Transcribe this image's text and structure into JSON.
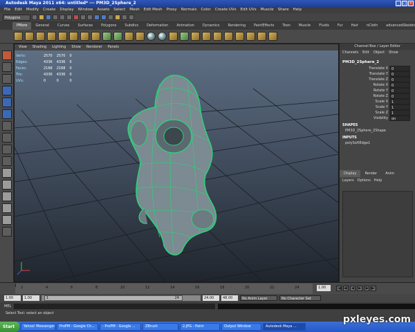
{
  "window": {
    "title": "Autodesk Maya 2011 x64: untitled*  ---  PM3D_2Sphere_2",
    "buttons": [
      "_",
      "□",
      "✕"
    ]
  },
  "menubar": [
    "File",
    "Edit",
    "Modify",
    "Create",
    "Display",
    "Window",
    "Assets",
    "Select",
    "Mesh",
    "Edit Mesh",
    "Proxy",
    "Normals",
    "Color",
    "Create UVs",
    "Edit UVs",
    "Muscle",
    "Share",
    "Help"
  ],
  "statusline": {
    "mode": "Polygons"
  },
  "shelf_tabs": [
    "PMore",
    "General",
    "Curves",
    "Surfaces",
    "Polygons",
    "Subdivs",
    "Deformation",
    "Animation",
    "Dynamics",
    "Rendering",
    "PaintEffects",
    "Toon",
    "Muscle",
    "Fluids",
    "Fur",
    "Hair",
    "nCloth",
    "advancedSkeleton"
  ],
  "shelf_active": "PMore",
  "viewport": {
    "menu": [
      "View",
      "Shading",
      "Lighting",
      "Show",
      "Renderer",
      "Panels"
    ],
    "hud": [
      {
        "label": "Verts:",
        "a": "2570",
        "b": "2570",
        "c": "0"
      },
      {
        "label": "Edges:",
        "a": "4336",
        "b": "4336",
        "c": "0"
      },
      {
        "label": "Faces:",
        "a": "2168",
        "b": "2168",
        "c": "0"
      },
      {
        "label": "Tris:",
        "a": "4336",
        "b": "4336",
        "c": "0"
      },
      {
        "label": "UVs:",
        "a": "0",
        "b": "0",
        "c": "0"
      }
    ],
    "mesh_color": "#2fd07a"
  },
  "channel_box": {
    "title": "Channel Box / Layer Editor",
    "menu": [
      "Channels",
      "Edit",
      "Object",
      "Show"
    ],
    "object": "PM3D_2Sphere_2",
    "attrs": [
      {
        "name": "Translate X",
        "value": "0"
      },
      {
        "name": "Translate Y",
        "value": "0"
      },
      {
        "name": "Translate Z",
        "value": "0"
      },
      {
        "name": "Rotate X",
        "value": "0"
      },
      {
        "name": "Rotate Y",
        "value": "0"
      },
      {
        "name": "Rotate Z",
        "value": "0"
      },
      {
        "name": "Scale X",
        "value": "1"
      },
      {
        "name": "Scale Y",
        "value": "1"
      },
      {
        "name": "Scale Z",
        "value": "1"
      },
      {
        "name": "Visibility",
        "value": "on"
      }
    ],
    "shapes_label": "SHAPES",
    "shape": "PM3D_2Sphere_2Shape",
    "inputs_label": "INPUTS",
    "input": "polySoftEdge1"
  },
  "layer_editor": {
    "tabs": [
      "Display",
      "Render",
      "Anim"
    ],
    "menu": [
      "Layers",
      "Options",
      "Help"
    ]
  },
  "timeline": {
    "ticks": [
      "2",
      "4",
      "6",
      "8",
      "10",
      "12",
      "14",
      "16",
      "18",
      "20",
      "22",
      "24"
    ],
    "current_frame": "1.00",
    "play_buttons": [
      "|◀",
      "◀|",
      "◀",
      "▶",
      "|▶",
      "▶|"
    ]
  },
  "range": {
    "start": "1.00",
    "start2": "1.00",
    "slider_start": "1",
    "slider_end": "24",
    "end": "24.00",
    "end2": "48.00",
    "anim_layer": "No Anim Layer",
    "character_set": "No Character Set"
  },
  "mel_label": "MEL",
  "help_text": "Select Tool: select an object",
  "taskbar": {
    "start": "Start",
    "tasks": [
      "Yahoo! Messenger",
      "ProPM - Google Ch...",
      "- ProPM - Google ...",
      "ZBrush",
      "2.JPG - Paint",
      "Output Window",
      "Autodesk Maya ..."
    ],
    "active_task": 6
  },
  "watermark": "pxleyes.com"
}
